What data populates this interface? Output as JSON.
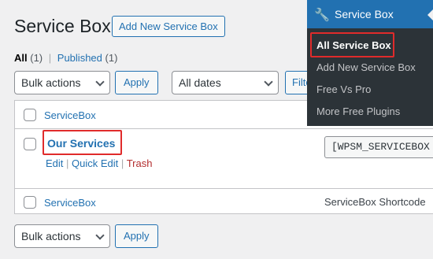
{
  "header": {
    "title": "Service Box",
    "add_new_label": "Add New Service Box"
  },
  "filters": {
    "all_label": "All",
    "all_count": "(1)",
    "published_label": "Published",
    "published_count": "(1)",
    "separator": "|"
  },
  "toolbar_top": {
    "bulk_actions": "Bulk actions",
    "apply": "Apply",
    "dates": "All dates",
    "filter_partial": "Filte"
  },
  "table": {
    "header_column": "ServiceBox",
    "row": {
      "title": "Our Services",
      "actions": [
        "Edit",
        "Quick Edit",
        "Trash"
      ],
      "shortcode": "[WPSM_SERVICEBOX"
    },
    "footer_column": "ServiceBox",
    "footer_shortcode_col": "ServiceBox Shortcode"
  },
  "toolbar_bottom": {
    "bulk_actions": "Bulk actions",
    "apply": "Apply"
  },
  "admin_menu": {
    "top_label": "Service Box",
    "top_icon": "wrench-icon",
    "items": [
      "All Service Box",
      "Add New Service Box",
      "Free Vs Pro",
      "More Free Plugins"
    ]
  },
  "colors": {
    "accent": "#2271b1",
    "highlight": "#e02b2b",
    "menu_bg": "#2c3338",
    "page_bg": "#f0f0f1"
  }
}
